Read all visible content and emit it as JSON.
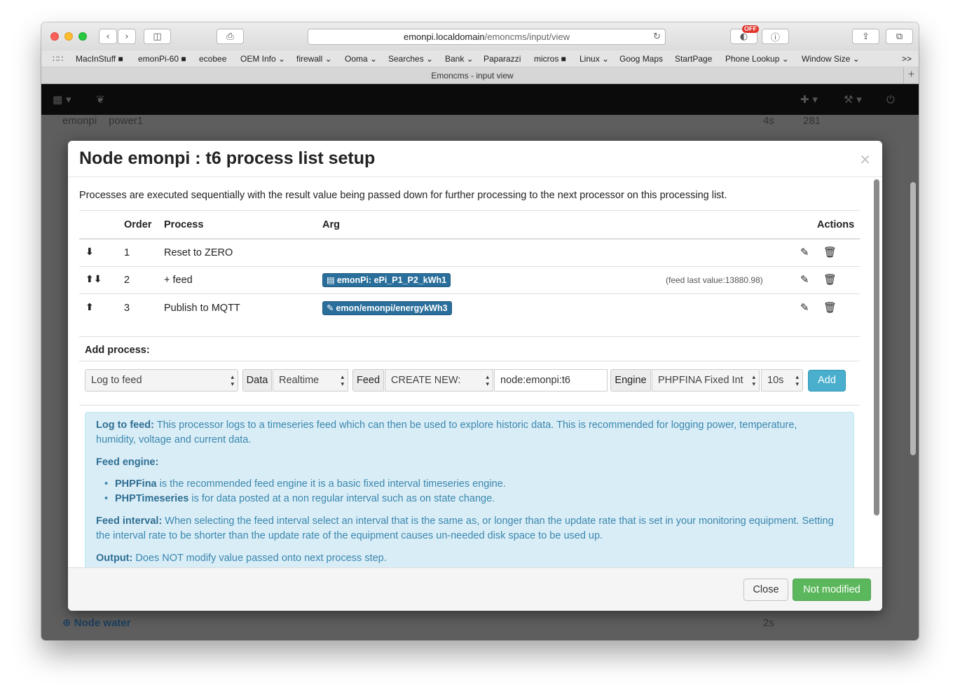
{
  "browser": {
    "url_host": "emonpi.localdomain",
    "url_path": "/emoncms/input/view",
    "tab_title": "Emoncms - input view",
    "ext_badge": "OFF",
    "bookmarks": [
      {
        "label": "MacInStuff ■"
      },
      {
        "label": "emonPi-60 ■"
      },
      {
        "label": "ecobee"
      },
      {
        "label": "OEM Info ⌄"
      },
      {
        "label": "firewall ⌄"
      },
      {
        "label": "Ooma ⌄"
      },
      {
        "label": "Searches ⌄"
      },
      {
        "label": "Bank ⌄"
      },
      {
        "label": "Paparazzi"
      },
      {
        "label": "micros ■"
      },
      {
        "label": "Linux ⌄"
      },
      {
        "label": "Goog Maps"
      },
      {
        "label": "StartPage"
      },
      {
        "label": "Phone Lookup ⌄"
      },
      {
        "label": "Window Size ⌄"
      }
    ],
    "overflow": ">>"
  },
  "background": {
    "row1_node": "emonpi",
    "row1_name": "power1",
    "row1_time": "4s",
    "row1_value": "281",
    "node_water": "Node water",
    "node_water_time": "2s"
  },
  "modal": {
    "title": "Node emonpi : t6 process list setup",
    "close": "×",
    "description": "Processes are executed sequentially with the result value being passed down for further processing to the next processor on this processing list.",
    "headers": {
      "order": "Order",
      "process": "Process",
      "arg": "Arg",
      "actions": "Actions"
    },
    "rows": [
      {
        "arrows": "⬇",
        "order": "1",
        "process": "Reset to ZERO",
        "arg": "",
        "arg_icon": ""
      },
      {
        "arrows": "⬆⬇",
        "order": "2",
        "process": "+ feed",
        "arg": "emonPi: ePi_P1_P2_kWh1",
        "arg_icon": "▤"
      },
      {
        "arrows": "⬆",
        "order": "3",
        "process": "Publish to MQTT",
        "arg": "emon/emonpi/energykWh3",
        "arg_icon": "✎"
      }
    ],
    "feed_last": "(feed last value:13880.98)",
    "add_process": {
      "label": "Add process:",
      "process_select": "Log to feed",
      "data_label": "Data",
      "data_select": "Realtime",
      "feed_label": "Feed",
      "feed_select": "CREATE NEW:",
      "feed_name": "node:emonpi:t6",
      "engine_label": "Engine",
      "engine_select": "PHPFINA Fixed Int",
      "interval_select": "10s",
      "add_button": "Add"
    },
    "info": {
      "log_title": "Log to feed:",
      "log_text": " This processor logs to a timeseries feed which can then be used to explore historic data. This is recommended for logging power, temperature, humidity, voltage and current data.",
      "engine_title": "Feed engine:",
      "engine_items": [
        {
          "name": "PHPFina",
          "text": " is the recommended feed engine it is a basic fixed interval timeseries engine."
        },
        {
          "name": "PHPTimeseries",
          "text": " is for data posted at a non regular interval such as on state change."
        }
      ],
      "interval_title": "Feed interval:",
      "interval_text": " When selecting the feed interval select an interval that is the same as, or longer than the update rate that is set in your monitoring equipment. Setting the interval rate to be shorter than the update rate of the equipment causes un-needed disk space to be used up.",
      "output_title": "Output:",
      "output_text": " Does NOT modify value passed onto next process step."
    },
    "footer": {
      "close": "Close",
      "save": "Not modified"
    }
  }
}
